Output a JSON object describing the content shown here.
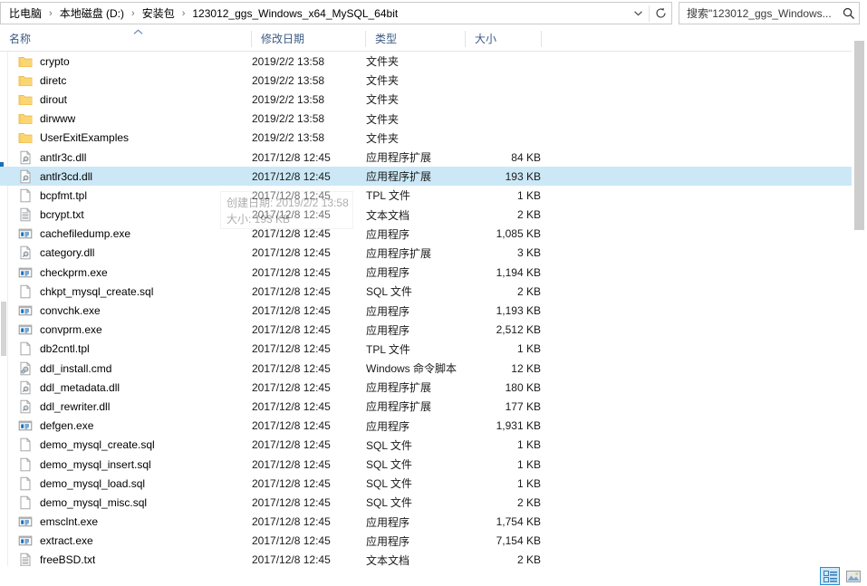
{
  "address_bar": {
    "breadcrumbs": [
      {
        "label": "比电脑"
      },
      {
        "label": "本地磁盘 (D:)"
      },
      {
        "label": "安装包"
      },
      {
        "label": "123012_ggs_Windows_x64_MySQL_64bit"
      }
    ],
    "separator": "›",
    "dropdown_icon": "chevron-down-icon",
    "refresh_icon": "refresh-icon",
    "refresh_glyph": "↻"
  },
  "search": {
    "value": "搜索\"123012_ggs_Windows...",
    "icon": "search-icon"
  },
  "columns": {
    "name": "名称",
    "date_modified": "修改日期",
    "type": "类型",
    "size": "大小",
    "sort_caret": "ⱏ"
  },
  "tooltip": {
    "line1": "创建日期: 2019/2/2 13:58",
    "line2": "大小: 193 KB"
  },
  "status_bar": {
    "details_view": "details-view-button",
    "icons_view": "large-icons-view-button"
  },
  "files": [
    {
      "name": "crypto",
      "date": "2019/2/2 13:58",
      "type": "文件夹",
      "size": "",
      "icon": "folder"
    },
    {
      "name": "diretc",
      "date": "2019/2/2 13:58",
      "type": "文件夹",
      "size": "",
      "icon": "folder"
    },
    {
      "name": "dirout",
      "date": "2019/2/2 13:58",
      "type": "文件夹",
      "size": "",
      "icon": "folder"
    },
    {
      "name": "dirwww",
      "date": "2019/2/2 13:58",
      "type": "文件夹",
      "size": "",
      "icon": "folder"
    },
    {
      "name": "UserExitExamples",
      "date": "2019/2/2 13:58",
      "type": "文件夹",
      "size": "",
      "icon": "folder"
    },
    {
      "name": "antlr3c.dll",
      "date": "2017/12/8 12:45",
      "type": "应用程序扩展",
      "size": "84 KB",
      "icon": "dll"
    },
    {
      "name": "antlr3cd.dll",
      "date": "2017/12/8 12:45",
      "type": "应用程序扩展",
      "size": "193 KB",
      "icon": "dll",
      "selected": true
    },
    {
      "name": "bcpfmt.tpl",
      "date": "2017/12/8 12:45",
      "type": "TPL 文件",
      "size": "1 KB",
      "icon": "blank"
    },
    {
      "name": "bcrypt.txt",
      "date": "2017/12/8 12:45",
      "type": "文本文档",
      "size": "2 KB",
      "icon": "text"
    },
    {
      "name": "cachefiledump.exe",
      "date": "2017/12/8 12:45",
      "type": "应用程序",
      "size": "1,085 KB",
      "icon": "exe"
    },
    {
      "name": "category.dll",
      "date": "2017/12/8 12:45",
      "type": "应用程序扩展",
      "size": "3 KB",
      "icon": "dll"
    },
    {
      "name": "checkprm.exe",
      "date": "2017/12/8 12:45",
      "type": "应用程序",
      "size": "1,194 KB",
      "icon": "exe"
    },
    {
      "name": "chkpt_mysql_create.sql",
      "date": "2017/12/8 12:45",
      "type": "SQL 文件",
      "size": "2 KB",
      "icon": "blank"
    },
    {
      "name": "convchk.exe",
      "date": "2017/12/8 12:45",
      "type": "应用程序",
      "size": "1,193 KB",
      "icon": "exe"
    },
    {
      "name": "convprm.exe",
      "date": "2017/12/8 12:45",
      "type": "应用程序",
      "size": "2,512 KB",
      "icon": "exe"
    },
    {
      "name": "db2cntl.tpl",
      "date": "2017/12/8 12:45",
      "type": "TPL 文件",
      "size": "1 KB",
      "icon": "blank"
    },
    {
      "name": "ddl_install.cmd",
      "date": "2017/12/8 12:45",
      "type": "Windows 命令脚本",
      "size": "12 KB",
      "icon": "cmd"
    },
    {
      "name": "ddl_metadata.dll",
      "date": "2017/12/8 12:45",
      "type": "应用程序扩展",
      "size": "180 KB",
      "icon": "dll"
    },
    {
      "name": "ddl_rewriter.dll",
      "date": "2017/12/8 12:45",
      "type": "应用程序扩展",
      "size": "177 KB",
      "icon": "dll"
    },
    {
      "name": "defgen.exe",
      "date": "2017/12/8 12:45",
      "type": "应用程序",
      "size": "1,931 KB",
      "icon": "exe"
    },
    {
      "name": "demo_mysql_create.sql",
      "date": "2017/12/8 12:45",
      "type": "SQL 文件",
      "size": "1 KB",
      "icon": "blank"
    },
    {
      "name": "demo_mysql_insert.sql",
      "date": "2017/12/8 12:45",
      "type": "SQL 文件",
      "size": "1 KB",
      "icon": "blank"
    },
    {
      "name": "demo_mysql_load.sql",
      "date": "2017/12/8 12:45",
      "type": "SQL 文件",
      "size": "1 KB",
      "icon": "blank"
    },
    {
      "name": "demo_mysql_misc.sql",
      "date": "2017/12/8 12:45",
      "type": "SQL 文件",
      "size": "2 KB",
      "icon": "blank"
    },
    {
      "name": "emsclnt.exe",
      "date": "2017/12/8 12:45",
      "type": "应用程序",
      "size": "1,754 KB",
      "icon": "exe"
    },
    {
      "name": "extract.exe",
      "date": "2017/12/8 12:45",
      "type": "应用程序",
      "size": "7,154 KB",
      "icon": "exe"
    },
    {
      "name": "freeBSD.txt",
      "date": "2017/12/8 12:45",
      "type": "文本文档",
      "size": "2 KB",
      "icon": "text"
    }
  ]
}
